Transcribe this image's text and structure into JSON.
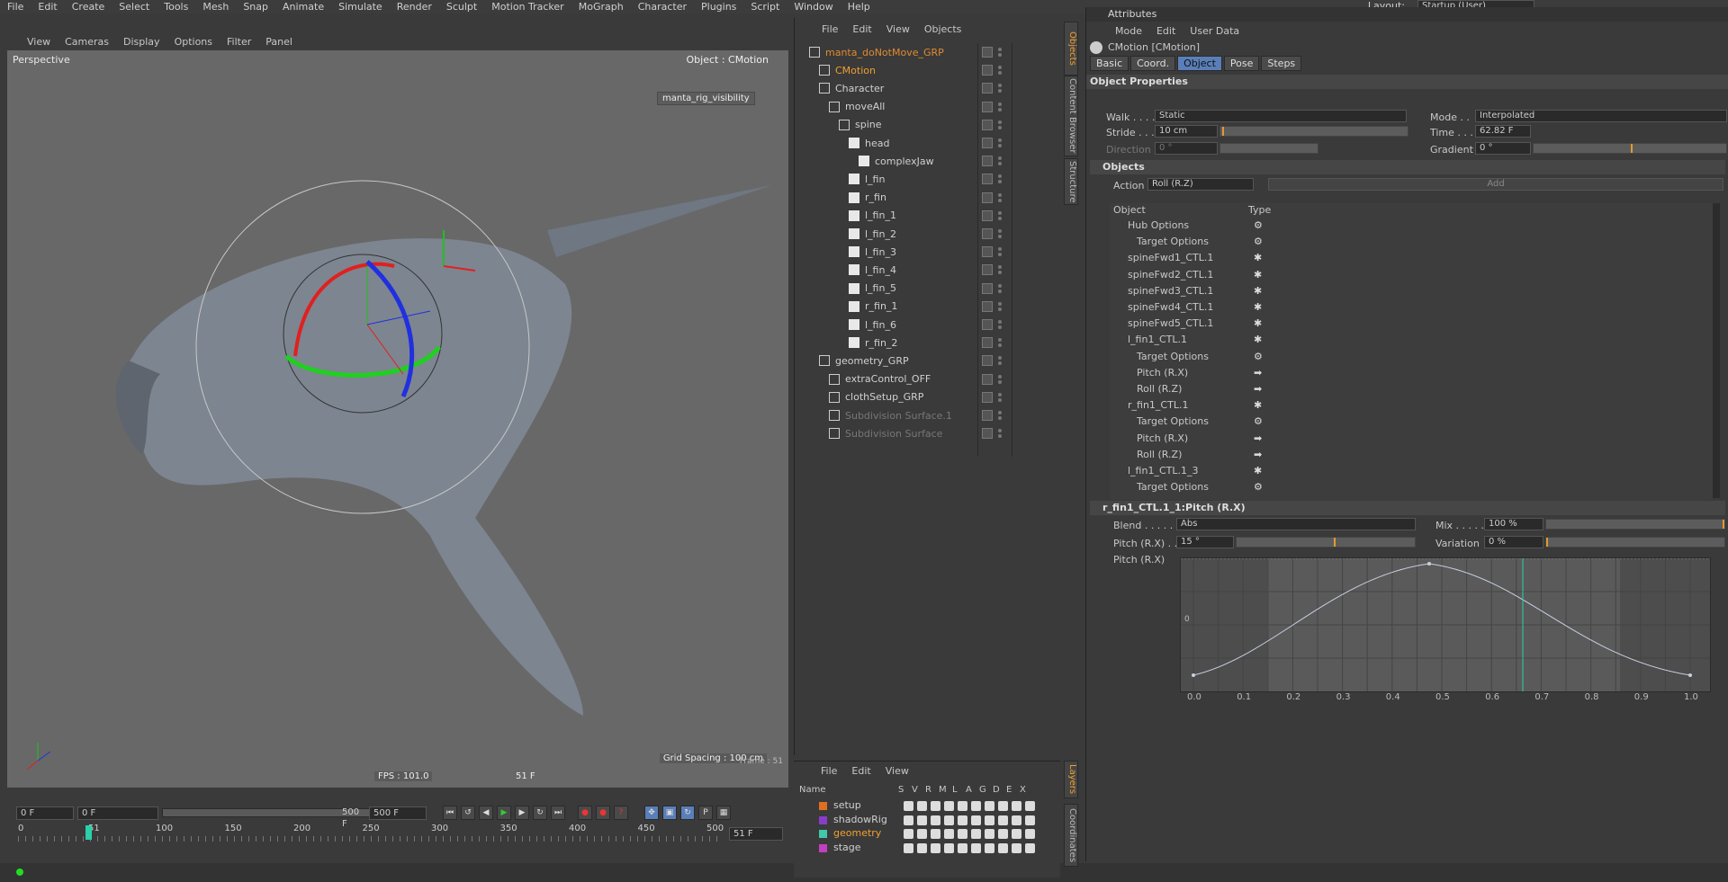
{
  "menubar": {
    "items": [
      "File",
      "Edit",
      "Create",
      "Select",
      "Tools",
      "Mesh",
      "Snap",
      "Animate",
      "Simulate",
      "Render",
      "Sculpt",
      "Motion Tracker",
      "MoGraph",
      "Character",
      "Plugins",
      "Script",
      "Window",
      "Help"
    ],
    "layout_label": "Layout:",
    "layout_value": "Startup (User)"
  },
  "viewport": {
    "menu": [
      "View",
      "Cameras",
      "Display",
      "Options",
      "Filter",
      "Panel"
    ],
    "name": "Perspective",
    "object_label": "Object : CMotion",
    "badge": "manta_rig_visibility",
    "fps": "FPS : 101.0",
    "frame_readout": "51 F",
    "grid_spacing": "Grid Spacing : 100 cm",
    "frame_small": "Frame : 51"
  },
  "timeline": {
    "start": "0 F",
    "range_start": "0 F",
    "range_end": "500 F",
    "end": "500 F",
    "current": "51 F",
    "ruler": [
      "0",
      "51",
      "100",
      "150",
      "200",
      "250",
      "300",
      "350",
      "400",
      "450",
      "500"
    ]
  },
  "objects": {
    "menu": [
      "File",
      "Edit",
      "View",
      "Objects"
    ],
    "items": [
      {
        "label": "manta_doNotMove_GRP",
        "depth": 0,
        "color": "#e08a30"
      },
      {
        "label": "CMotion",
        "depth": 1,
        "color": "#f0a030"
      },
      {
        "label": "Character",
        "depth": 1,
        "color": "#d0d0d0"
      },
      {
        "label": "moveAll",
        "depth": 2,
        "color": "#d0d0d0"
      },
      {
        "label": "spine",
        "depth": 3,
        "color": "#d0d0d0"
      },
      {
        "label": "head",
        "depth": 4,
        "color": "#d0d0d0"
      },
      {
        "label": "complexJaw",
        "depth": 5,
        "color": "#d0d0d0"
      },
      {
        "label": "l_fin",
        "depth": 4,
        "color": "#d0d0d0"
      },
      {
        "label": "r_fin",
        "depth": 4,
        "color": "#d0d0d0"
      },
      {
        "label": "l_fin_1",
        "depth": 4,
        "color": "#d0d0d0"
      },
      {
        "label": "l_fin_2",
        "depth": 4,
        "color": "#d0d0d0"
      },
      {
        "label": "l_fin_3",
        "depth": 4,
        "color": "#d0d0d0"
      },
      {
        "label": "l_fin_4",
        "depth": 4,
        "color": "#d0d0d0"
      },
      {
        "label": "l_fin_5",
        "depth": 4,
        "color": "#d0d0d0"
      },
      {
        "label": "r_fin_1",
        "depth": 4,
        "color": "#d0d0d0"
      },
      {
        "label": "l_fin_6",
        "depth": 4,
        "color": "#d0d0d0"
      },
      {
        "label": "r_fin_2",
        "depth": 4,
        "color": "#d0d0d0"
      },
      {
        "label": "geometry_GRP",
        "depth": 1,
        "color": "#d0d0d0"
      },
      {
        "label": "extraControl_OFF",
        "depth": 2,
        "color": "#d0d0d0"
      },
      {
        "label": "clothSetup_GRP",
        "depth": 2,
        "color": "#d0d0d0"
      },
      {
        "label": "Subdivision Surface.1",
        "depth": 2,
        "color": "#777777"
      },
      {
        "label": "Subdivision Surface",
        "depth": 2,
        "color": "#777777"
      }
    ]
  },
  "side_tabs": [
    "Objects",
    "Content Browser",
    "Structure",
    "Layers",
    "Coordinates"
  ],
  "layers": {
    "menu": [
      "File",
      "Edit",
      "View"
    ],
    "header": [
      "Name",
      "S",
      "V",
      "R",
      "M",
      "L",
      "A",
      "G",
      "D",
      "E",
      "X"
    ],
    "rows": [
      {
        "name": "setup",
        "color": "#e07020",
        "name_color": "#d0d0d0"
      },
      {
        "name": "shadowRig",
        "color": "#8a3cc8",
        "name_color": "#d0d0d0"
      },
      {
        "name": "geometry",
        "color": "#40c8a8",
        "name_color": "#f0a030"
      },
      {
        "name": "stage",
        "color": "#c040c0",
        "name_color": "#d0d0d0"
      }
    ]
  },
  "attributes": {
    "title": "Attributes",
    "menu": [
      "Mode",
      "Edit",
      "User Data"
    ],
    "object_name": "CMotion [CMotion]",
    "tabs": [
      {
        "label": "Basic",
        "active": false
      },
      {
        "label": "Coord.",
        "active": false
      },
      {
        "label": "Object",
        "active": true
      },
      {
        "label": "Pose",
        "active": false
      },
      {
        "label": "Steps",
        "active": false
      }
    ],
    "section_title": "Object Properties",
    "walk_label": "Walk . . . .",
    "walk_value": "Static",
    "mode_label": "Mode . .",
    "mode_value": "Interpolated",
    "stride_label": "Stride . . .",
    "stride_value": "10 cm",
    "time_label": "Time . . .",
    "time_value": "62.82 F",
    "direction_label": "Direction",
    "direction_value": "0 °",
    "gradient_label": "Gradient",
    "gradient_value": "0 °",
    "objects_section": "Objects",
    "action_label": "Action",
    "action_value": "Roll (R.Z)",
    "add_button": "Add",
    "list_header_object": "Object",
    "list_header_type": "Type",
    "list": [
      {
        "label": "Hub Options",
        "depth": 0,
        "kind": "gear"
      },
      {
        "label": "Target Options",
        "depth": 1,
        "kind": "gear"
      },
      {
        "label": "spineFwd1_CTL.1",
        "depth": 0,
        "kind": "star"
      },
      {
        "label": "spineFwd2_CTL.1",
        "depth": 0,
        "kind": "star"
      },
      {
        "label": "spineFwd3_CTL.1",
        "depth": 0,
        "kind": "star"
      },
      {
        "label": "spineFwd4_CTL.1",
        "depth": 0,
        "kind": "star"
      },
      {
        "label": "spineFwd5_CTL.1",
        "depth": 0,
        "kind": "star"
      },
      {
        "label": "l_fin1_CTL.1",
        "depth": 0,
        "kind": "star"
      },
      {
        "label": "Target Options",
        "depth": 1,
        "kind": "gear"
      },
      {
        "label": "Pitch (R.X)",
        "depth": 1,
        "kind": "arrow"
      },
      {
        "label": "Roll (R.Z)",
        "depth": 1,
        "kind": "arrow"
      },
      {
        "label": "r_fin1_CTL.1",
        "depth": 0,
        "kind": "star"
      },
      {
        "label": "Target Options",
        "depth": 1,
        "kind": "gear"
      },
      {
        "label": "Pitch (R.X)",
        "depth": 1,
        "kind": "arrow"
      },
      {
        "label": "Roll (R.Z)",
        "depth": 1,
        "kind": "arrow"
      },
      {
        "label": "l_fin1_CTL.1_3",
        "depth": 0,
        "kind": "star"
      },
      {
        "label": "Target Options",
        "depth": 1,
        "kind": "gear"
      }
    ],
    "sub_section": "r_fin1_CTL.1_1:Pitch (R.X)",
    "blend_label": "Blend . . . . .",
    "blend_value": "Abs",
    "mix_label": "Mix . . . . .",
    "mix_value": "100 %",
    "pitch_label": "Pitch (R.X) . .",
    "pitch_value": "15 °",
    "variation_label": "Variation",
    "variation_value": "0 %",
    "curve_label": "Pitch (R.X)",
    "graph_y_zero": "0",
    "graph_x": [
      "0.0",
      "0.1",
      "0.2",
      "0.3",
      "0.4",
      "0.5",
      "0.6",
      "0.7",
      "0.8",
      "0.9",
      "1.0"
    ]
  },
  "colors": {
    "accent": "#f0a030",
    "tab_active": "#5a7fb8",
    "gizmo_red": "#e02020",
    "gizmo_green": "#20d020",
    "gizmo_blue": "#2030e0"
  }
}
